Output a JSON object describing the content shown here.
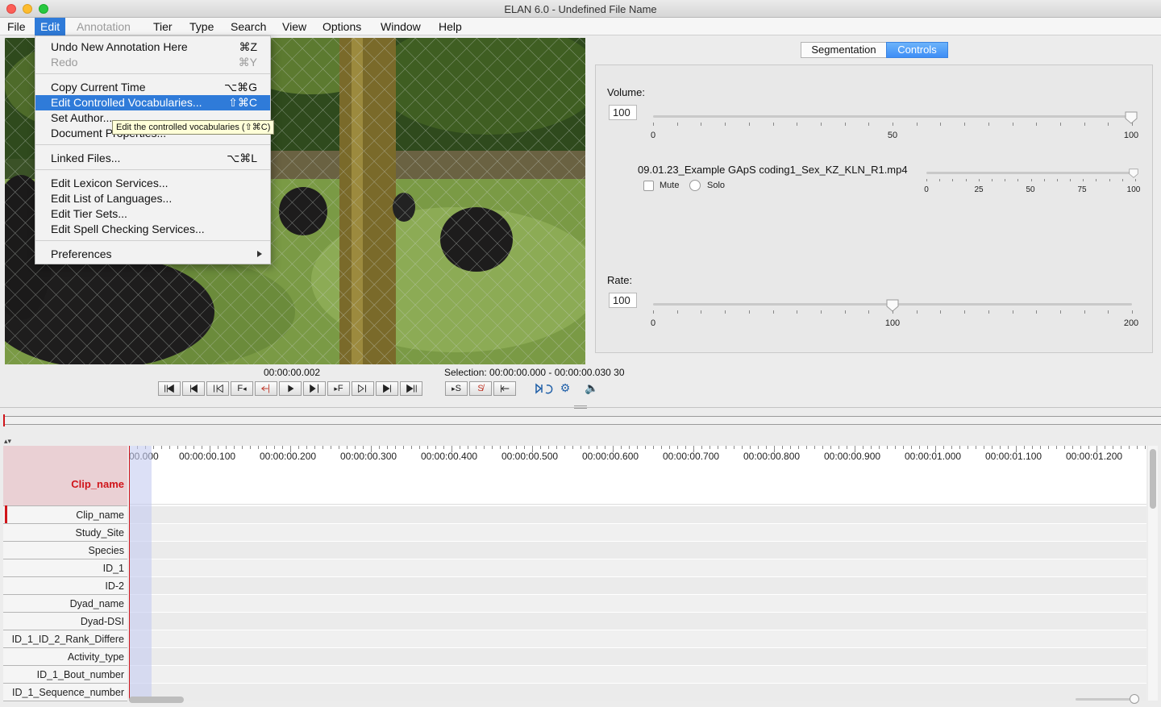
{
  "window": {
    "title": "ELAN 6.0 - Undefined File Name"
  },
  "menubar": [
    {
      "label": "File",
      "state": "normal"
    },
    {
      "label": "Edit",
      "state": "active"
    },
    {
      "label": "Annotation",
      "state": "disabled"
    },
    {
      "label": "Tier",
      "state": "normal"
    },
    {
      "label": "Type",
      "state": "normal"
    },
    {
      "label": "Search",
      "state": "normal"
    },
    {
      "label": "View",
      "state": "normal"
    },
    {
      "label": "Options",
      "state": "normal"
    },
    {
      "label": "Window",
      "state": "normal"
    },
    {
      "label": "Help",
      "state": "normal"
    }
  ],
  "edit_menu": {
    "items": [
      {
        "label": "Undo New Annotation Here",
        "shortcut": "⌘Z",
        "disabled": false
      },
      {
        "label": "Redo",
        "shortcut": "⌘Y",
        "disabled": true
      },
      {
        "label": "Copy Current Time",
        "shortcut": "⌥⌘G",
        "disabled": false
      },
      {
        "label": "Edit Controlled Vocabularies...",
        "shortcut": "⇧⌘C",
        "highlighted": true
      },
      {
        "label": "Set Author...",
        "shortcut": ""
      },
      {
        "label": "Document Properties...",
        "shortcut": ""
      },
      {
        "label": "Linked Files...",
        "shortcut": "⌥⌘L"
      },
      {
        "label": "Edit Lexicon Services...",
        "shortcut": ""
      },
      {
        "label": "Edit List of Languages...",
        "shortcut": ""
      },
      {
        "label": "Edit Tier Sets...",
        "shortcut": ""
      },
      {
        "label": "Edit Spell Checking Services...",
        "shortcut": ""
      },
      {
        "label": "Preferences",
        "shortcut": "",
        "submenu": true
      }
    ],
    "tooltip": "Edit the controlled vocabularies (⇧⌘C)"
  },
  "right_panel": {
    "tabs": [
      {
        "label": "Segmentation",
        "selected": false
      },
      {
        "label": "Controls",
        "selected": true
      }
    ],
    "volume": {
      "label": "Volume:",
      "value": "100",
      "level": 100,
      "ticks": [
        "0",
        "50",
        "100"
      ]
    },
    "media": {
      "file_name": "09.01.23_Example GApS coding1_Sex_KZ_KLN_R1.mp4",
      "mute_label": "Mute",
      "solo_label": "Solo",
      "level": 100,
      "ticks": [
        "0",
        "25",
        "50",
        "75",
        "100"
      ]
    },
    "rate": {
      "label": "Rate:",
      "value": "100",
      "level": 100,
      "ticks": [
        "0",
        "100",
        "200"
      ]
    }
  },
  "player": {
    "current_time": "00:00:00.002",
    "selection": "Selection: 00:00:00.000 - 00:00:00.030  30"
  },
  "timeline": {
    "ruler_labels": [
      "00.000",
      "00:00:00.100",
      "00:00:00.200",
      "00:00:00.300",
      "00:00:00.400",
      "00:00:00.500",
      "00:00:00.600",
      "00:00:00.700",
      "00:00:00.800",
      "00:00:00.900",
      "00:00:01.000",
      "00:00:01.100",
      "00:00:01.200"
    ],
    "active_tier": "Clip_name",
    "tiers": [
      "Clip_name",
      "Study_Site",
      "Species",
      "ID_1",
      "ID-2",
      "Dyad_name",
      "Dyad-DSI",
      "ID_1_ID_2_Rank_Differe",
      "Activity_type",
      "ID_1_Bout_number",
      "ID_1_Sequence_number"
    ]
  },
  "colors": {
    "accent": "#2f7bd9",
    "active_tier_text": "#d0141a",
    "active_tier_bg": "#ead0d4",
    "selection_band": "#d5dbf3"
  }
}
